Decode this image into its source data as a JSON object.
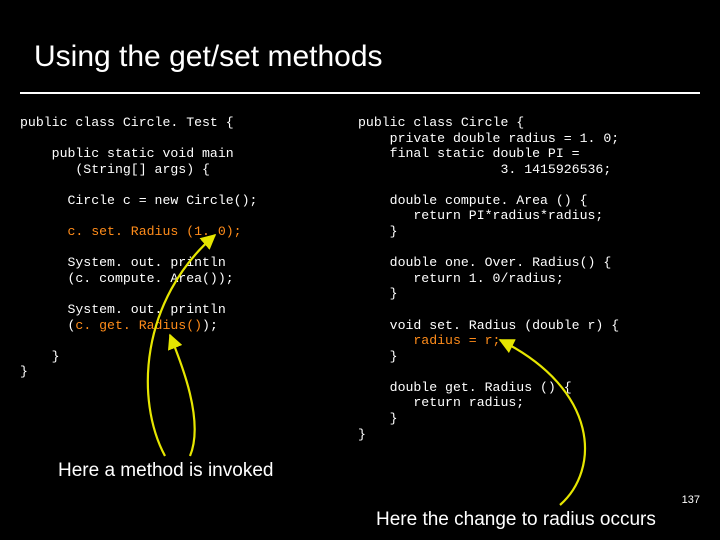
{
  "title": "Using the get/set methods",
  "left_code": {
    "l01": "public class Circle. Test {",
    "l02": "",
    "l03": "    public static void main",
    "l04": "       (String[] args) {",
    "l05": "",
    "l06": "      Circle c = new Circle();",
    "l07": "",
    "l08": "      ",
    "l08o": "c. set. Radius (1. 0);",
    "l09": "",
    "l10": "      System. out. println",
    "l11": "      (c. compute. Area());",
    "l12": "",
    "l13": "      System. out. println",
    "l14": "      (",
    "l14o": "c. get. Radius()",
    "l14b": ");",
    "l15": "",
    "l16": "    }",
    "l17": "}"
  },
  "right_code": {
    "r01": "public class Circle {",
    "r02": "    private double radius = 1. 0;",
    "r03": "    final static double PI =",
    "r04": "                  3. 1415926536;",
    "r05": "",
    "r06": "    double compute. Area () {",
    "r07": "       return PI*radius*radius;",
    "r08": "    }",
    "r09": "",
    "r10": "    double one. Over. Radius() {",
    "r11": "       return 1. 0/radius;",
    "r12": "    }",
    "r13": "",
    "r14": "    void set. Radius (double r) {",
    "r15o": "       radius = r;",
    "r16": "    }",
    "r17": "",
    "r18": "    double get. Radius () {",
    "r19": "       return radius;",
    "r20": "    }",
    "r21": "}"
  },
  "caption_left": "Here a method is invoked",
  "caption_right": "Here the change to radius occurs",
  "page_number": "137"
}
